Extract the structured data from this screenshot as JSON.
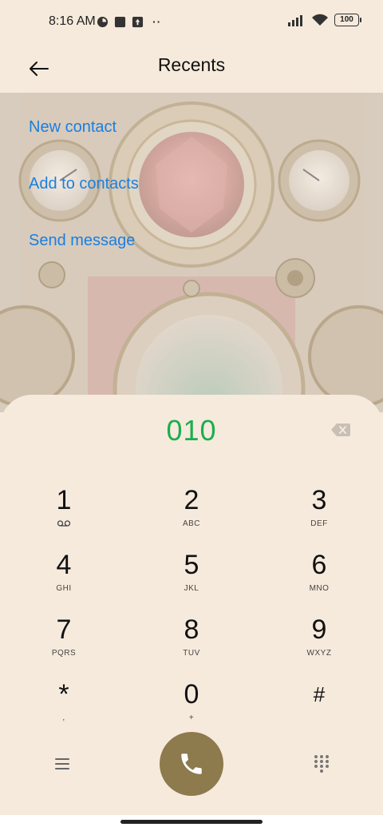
{
  "status_bar": {
    "time": "8:16 AM",
    "battery": "100",
    "icons_left": [
      "app-notification-icon",
      "square-icon",
      "upload-icon"
    ],
    "more": "··",
    "icons_right": [
      "signal-icon",
      "wifi-icon",
      "battery-icon"
    ]
  },
  "header": {
    "title": "Recents",
    "back_icon": "back-arrow-icon"
  },
  "actions": [
    {
      "label": "New contact"
    },
    {
      "label": "Add to contacts"
    },
    {
      "label": "Send message"
    }
  ],
  "dialpad": {
    "number": "010",
    "keys": [
      {
        "digit": "1",
        "letters": ""
      },
      {
        "digit": "2",
        "letters": "ABC"
      },
      {
        "digit": "3",
        "letters": "DEF"
      },
      {
        "digit": "4",
        "letters": "GHI"
      },
      {
        "digit": "5",
        "letters": "JKL"
      },
      {
        "digit": "6",
        "letters": "MNO"
      },
      {
        "digit": "7",
        "letters": "PQRS"
      },
      {
        "digit": "8",
        "letters": "TUV"
      },
      {
        "digit": "9",
        "letters": "WXYZ"
      },
      {
        "digit": "*",
        "letters": ","
      },
      {
        "digit": "0",
        "letters": "+"
      },
      {
        "digit": "#",
        "letters": ""
      }
    ]
  },
  "colors": {
    "background": "#f6eadc",
    "action_link": "#1a7fe0",
    "number": "#1aae4e",
    "call_button": "#8d7a4d"
  }
}
